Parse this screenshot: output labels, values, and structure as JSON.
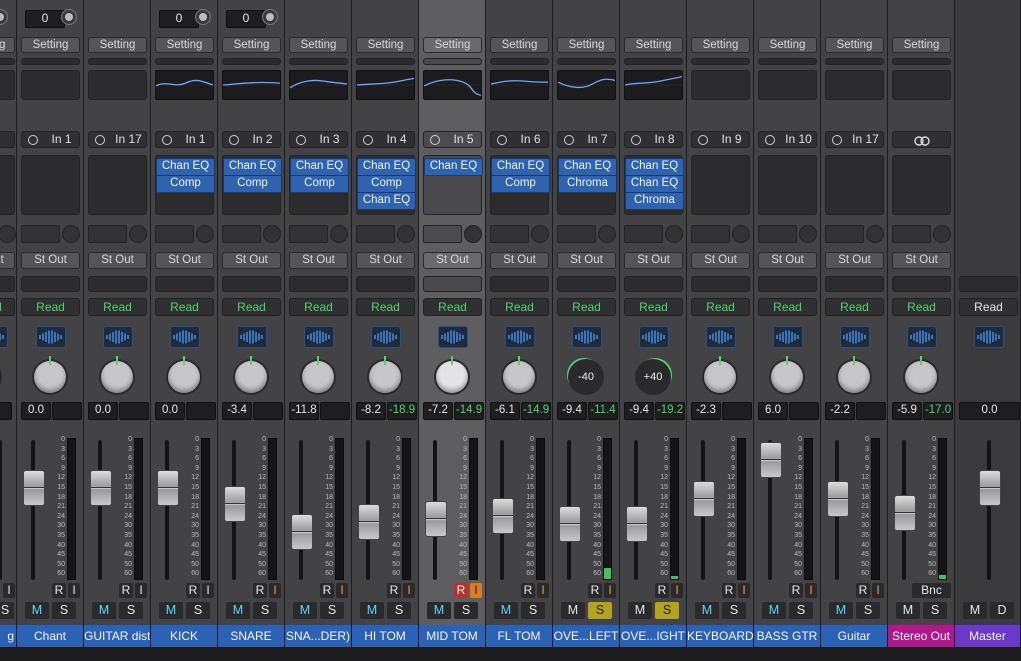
{
  "strips": [
    {
      "name": "",
      "vol": "",
      "peak": "",
      "input": "",
      "setting": "",
      "plugins": [],
      "pan": "",
      "fader": 0.75,
      "partial": true
    },
    {
      "name": "Chant",
      "vol": "0.0",
      "peak": "",
      "input": "In 1",
      "setting": "Setting",
      "plugins": [],
      "pan": "",
      "fader": 0.75,
      "gain": "0"
    },
    {
      "name": "GUITAR dist",
      "vol": "0.0",
      "peak": "",
      "input": "In 17",
      "setting": "Setting",
      "plugins": [],
      "pan": "",
      "fader": 0.75
    },
    {
      "name": "KICK",
      "vol": "0.0",
      "peak": "",
      "input": "In 1",
      "setting": "Setting",
      "plugins": [
        "Chan EQ",
        "Comp"
      ],
      "pan": "",
      "fader": 0.75,
      "gain": "0"
    },
    {
      "name": "SNARE",
      "vol": "-3.4",
      "peak": "",
      "input": "In 2",
      "setting": "Setting",
      "plugins": [
        "Chan EQ",
        "Comp"
      ],
      "pan": "",
      "fader": 0.62,
      "gain": "0"
    },
    {
      "name": "SNA...DER)",
      "vol": "-11.8",
      "peak": "",
      "input": "In 3",
      "setting": "Setting",
      "plugins": [
        "Chan EQ",
        "Comp"
      ],
      "pan": "",
      "fader": 0.38
    },
    {
      "name": "HI TOM",
      "vol": "-8.2",
      "peak": "-18.9",
      "input": "In 4",
      "setting": "Setting",
      "plugins": [
        "Chan EQ",
        "Comp",
        "Chan EQ"
      ],
      "pan": "",
      "fader": 0.47
    },
    {
      "name": "MID TOM",
      "vol": "-7.2",
      "peak": "-14.9",
      "input": "In 5",
      "setting": "Setting",
      "plugins": [
        "Chan EQ"
      ],
      "pan": "",
      "fader": 0.49,
      "selected": true
    },
    {
      "name": "FL TOM",
      "vol": "-6.1",
      "peak": "-14.9",
      "input": "In 6",
      "setting": "Setting",
      "plugins": [
        "Chan EQ",
        "Comp"
      ],
      "pan": "",
      "fader": 0.52
    },
    {
      "name": "OVE...LEFT",
      "vol": "-9.4",
      "peak": "-11.4",
      "input": "In 7",
      "setting": "Setting",
      "plugins": [
        "Chan EQ",
        "Chroma"
      ],
      "pan": "-40",
      "fader": 0.45
    },
    {
      "name": "OVE...IGHT",
      "vol": "-9.4",
      "peak": "-19.2",
      "input": "In 8",
      "setting": "Setting",
      "plugins": [
        "Chan EQ",
        "Chan EQ",
        "Chroma"
      ],
      "pan": "+40",
      "fader": 0.45
    },
    {
      "name": "KEYBOARD",
      "vol": "-2.3",
      "peak": "",
      "input": "In 9",
      "setting": "Setting",
      "plugins": [],
      "pan": "",
      "fader": 0.66
    },
    {
      "name": "BASS GTR",
      "vol": "6.0",
      "peak": "",
      "input": "In 10",
      "setting": "Setting",
      "plugins": [],
      "pan": "",
      "fader": 0.98
    },
    {
      "name": "Guitar",
      "vol": "-2.2",
      "peak": "",
      "input": "In 17",
      "setting": "Setting",
      "plugins": [],
      "pan": "",
      "fader": 0.66
    },
    {
      "name": "Stereo Out",
      "vol": "-5.9",
      "peak": "-17.0",
      "input": "",
      "setting": "Setting",
      "plugins": [],
      "pan": "",
      "fader": 0.54
    },
    {
      "name": "Master",
      "vol": "0.0",
      "peak": "",
      "input": "",
      "setting": "",
      "plugins": [],
      "pan": "",
      "fader": 0.75
    }
  ],
  "labels": {
    "output": "St Out",
    "automation": "Read",
    "record": "R",
    "input_monitor": "I",
    "mute": "M",
    "solo": "S",
    "bounce": "Bnc",
    "dim": "D"
  },
  "scale": [
    "0",
    "3",
    "6",
    "9",
    "12",
    "15",
    "18",
    "21",
    "24",
    "30",
    "35",
    "40",
    "45",
    "50",
    "60"
  ],
  "colors": {
    "track_name": "#2b62b6",
    "stereo_out": "#b0188e",
    "master": "#6a39c9",
    "plugin": "#2f63b0",
    "automation_read": "#4fd46a",
    "solo_on": "#b5a21e",
    "record_on": "#b8322c",
    "input_on": "#e07a1c"
  },
  "icons": {
    "input_ring": "ring-icon",
    "stereo_link": "stereo-link-icon",
    "waveform": "waveform-icon",
    "gain": "gain-knob-icon"
  }
}
